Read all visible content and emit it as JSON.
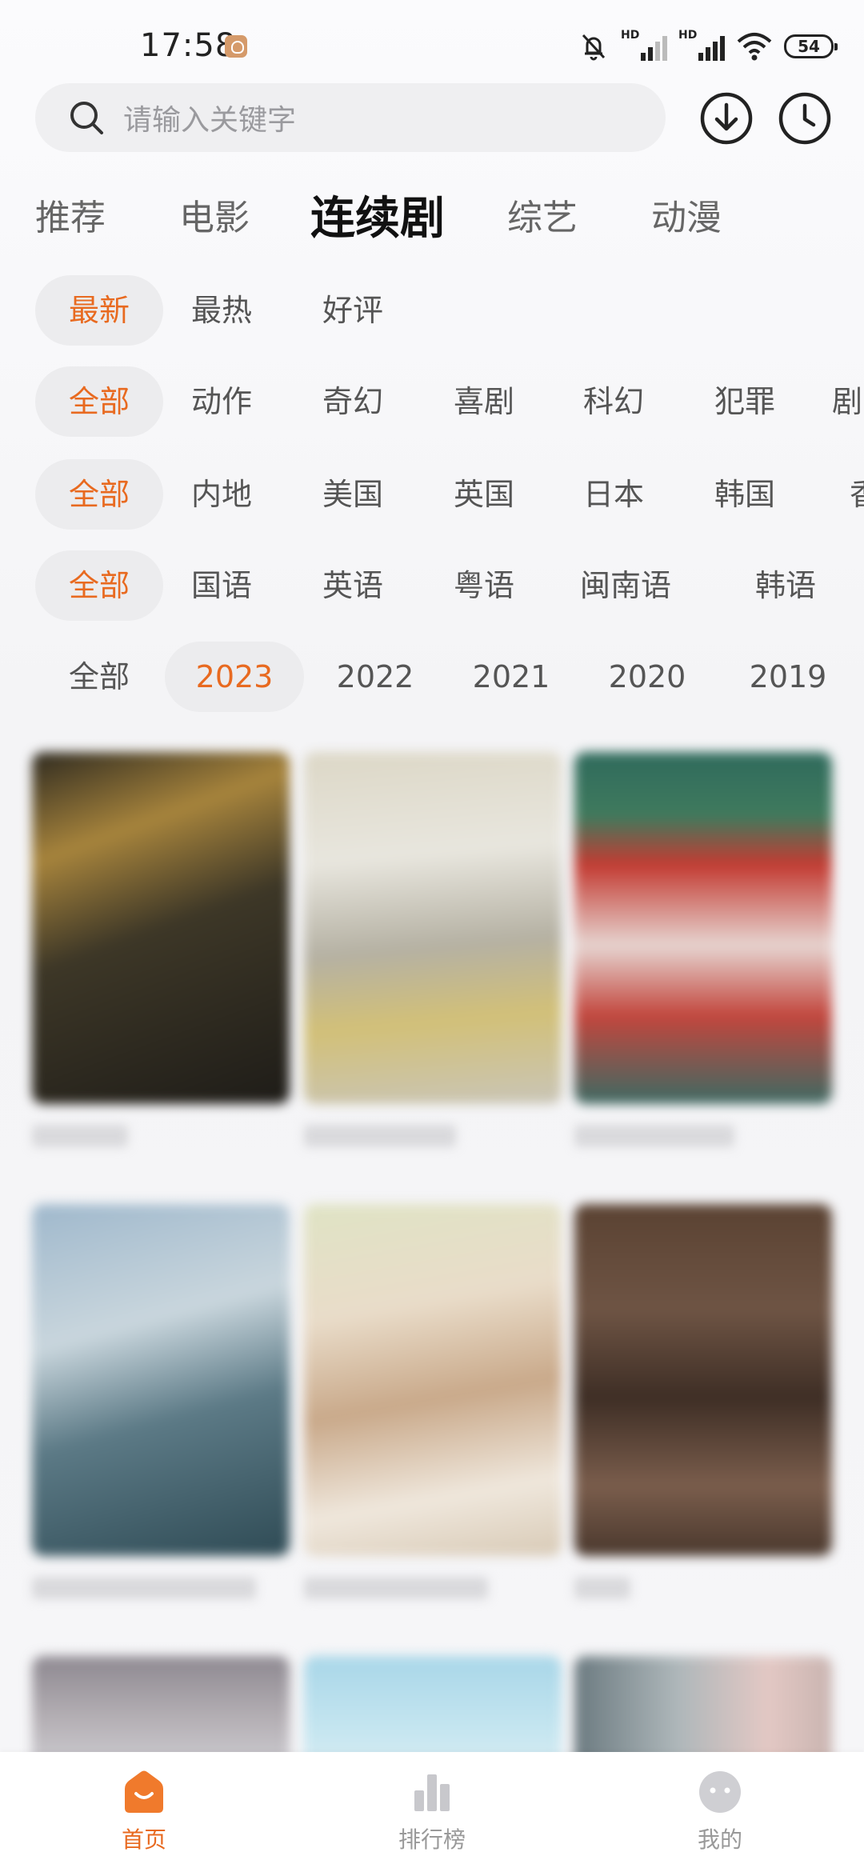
{
  "status_bar": {
    "time": "17:58",
    "network_label": "HD",
    "battery": "54"
  },
  "search": {
    "placeholder": "请输入关键字"
  },
  "category_tabs": [
    "推荐",
    "电影",
    "连续剧",
    "综艺",
    "动漫"
  ],
  "active_category": "连续剧",
  "filters": {
    "sort": {
      "options": [
        "最新",
        "最热",
        "好评"
      ],
      "selected": "最新"
    },
    "genre": {
      "options": [
        "全部",
        "动作",
        "奇幻",
        "喜剧",
        "科幻",
        "犯罪",
        "剧"
      ],
      "selected": "全部"
    },
    "region": {
      "options": [
        "全部",
        "内地",
        "美国",
        "英国",
        "日本",
        "韩国",
        "香"
      ],
      "selected": "全部"
    },
    "language": {
      "options": [
        "全部",
        "国语",
        "英语",
        "粤语",
        "闽南语",
        "韩语"
      ],
      "selected": "全部"
    },
    "year": {
      "options": [
        "全部",
        "2023",
        "2022",
        "2021",
        "2020",
        "2019"
      ],
      "selected": "2023"
    }
  },
  "bottom_nav": {
    "items": [
      {
        "label": "首页",
        "icon": "home-icon",
        "active": true
      },
      {
        "label": "排行榜",
        "icon": "chart-icon",
        "active": false
      },
      {
        "label": "我的",
        "icon": "profile-face-icon",
        "active": false
      }
    ]
  },
  "colors": {
    "accent": "#e86a20",
    "chip_bg": "#ececee"
  }
}
